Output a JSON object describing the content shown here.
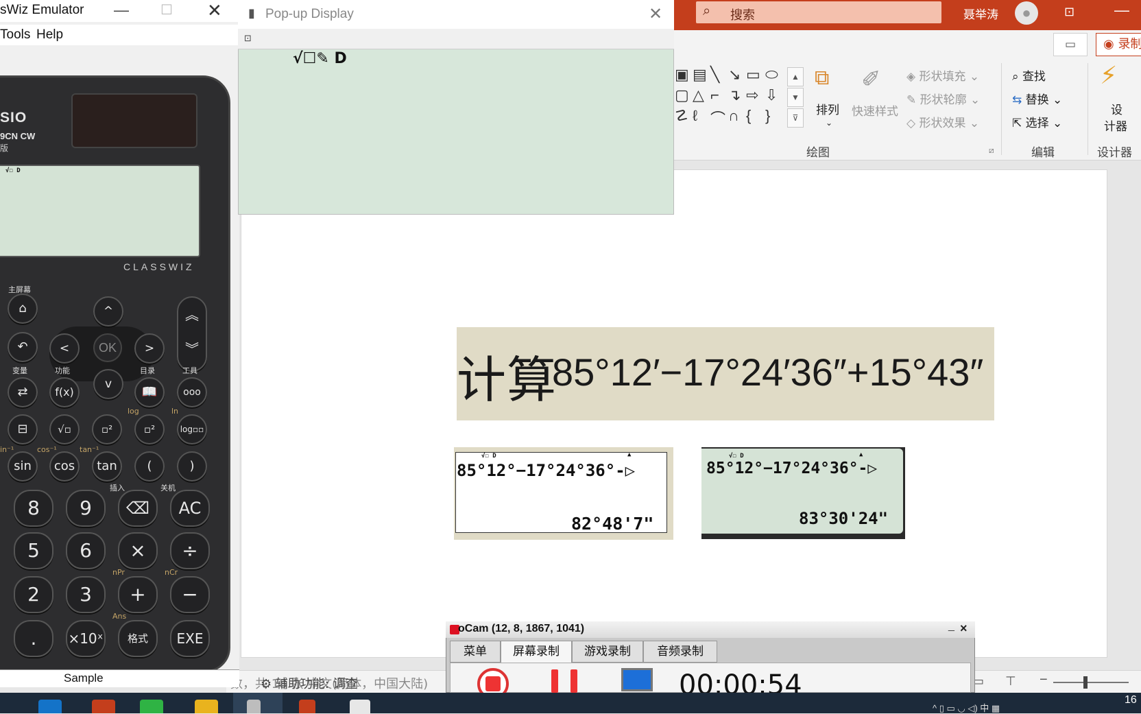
{
  "calculator_window": {
    "title": "sWiz Emulator",
    "menu": {
      "tools": "Tools",
      "help": "Help"
    },
    "brand": "SIO",
    "model": "9CN CW",
    "model_sub": "版",
    "classwiz_label": "CLASSWIZ",
    "screen_indicator": "√☐ D",
    "home_label": "主屏幕",
    "labels": {
      "variable": "变量",
      "function": "功能",
      "catalog": "目录",
      "tools": "工具",
      "insert": "插入",
      "off": "关机",
      "log": "log",
      "ln": "ln",
      "sin_inv": "in⁻¹",
      "cos_inv": "cos⁻¹",
      "tan_inv": "tan⁻¹",
      "npr": "nPr",
      "ncr": "nCr",
      "ans": "Ans"
    },
    "keys": {
      "left": "<",
      "right": ">",
      "up": "^",
      "down": "v",
      "ok": "OK",
      "fx": "f(x)",
      "book": "▭",
      "dots": "ooo",
      "frac": "▭",
      "sqrt": "√▫",
      "pow": "▫²",
      "sq": "▫²",
      "logbox": "log▫▫",
      "sin": "sin",
      "cos": "cos",
      "tan": "tan",
      "lparen": "(",
      "rparen": ")",
      "k8": "8",
      "k9": "9",
      "del": "⌫",
      "ac": "AC",
      "k5": "5",
      "k6": "6",
      "times": "×",
      "div": "÷",
      "k2": "2",
      "k3": "3",
      "plus": "+",
      "minus": "−",
      "dot": ".",
      "exp": "×10ˣ",
      "format": "格式",
      "exe": "EXE"
    },
    "sample_label": "Sample"
  },
  "popup_window": {
    "title": "Pop-up Display",
    "indicator": "√☐✎ D"
  },
  "powerpoint": {
    "search_placeholder": "搜索",
    "user_name": "聂举涛",
    "record_label": "录制",
    "ribbon": {
      "arrange": "排列",
      "quick_styles": "快速样式",
      "shape_fill": "形状填充",
      "shape_outline": "形状轮廓",
      "shape_effects": "形状效果",
      "find": "查找",
      "replace": "替换",
      "select": "选择",
      "designer_line1": "设",
      "designer_line2": "计器",
      "group_drawing": "绘图",
      "group_editing": "编辑",
      "group_designer": "设计器"
    },
    "status": {
      "left_text": "数，共 18 张   中文(简体，中国大陆)",
      "accessibility": "辅助功能: 调查"
    },
    "slide": {
      "formula_label": "计算",
      "formula_expression": "85°12′−17°24′36″+15°43″",
      "shot1": {
        "indicator": "√☐ D",
        "line1": "85°12°−17°24°36°-▷",
        "result": "82°48'7\""
      },
      "shot2": {
        "indicator": "√☐ D",
        "line1": "85°12°−17°24°36°-▷",
        "result": "83°30'24\""
      }
    }
  },
  "ocam": {
    "title": "oCam (12, 8, 1867, 1041)",
    "tabs": [
      "菜单",
      "屏幕录制",
      "游戏录制",
      "音频录制"
    ],
    "timer": "00:00:54"
  },
  "taskbar": {
    "clock": "16"
  }
}
